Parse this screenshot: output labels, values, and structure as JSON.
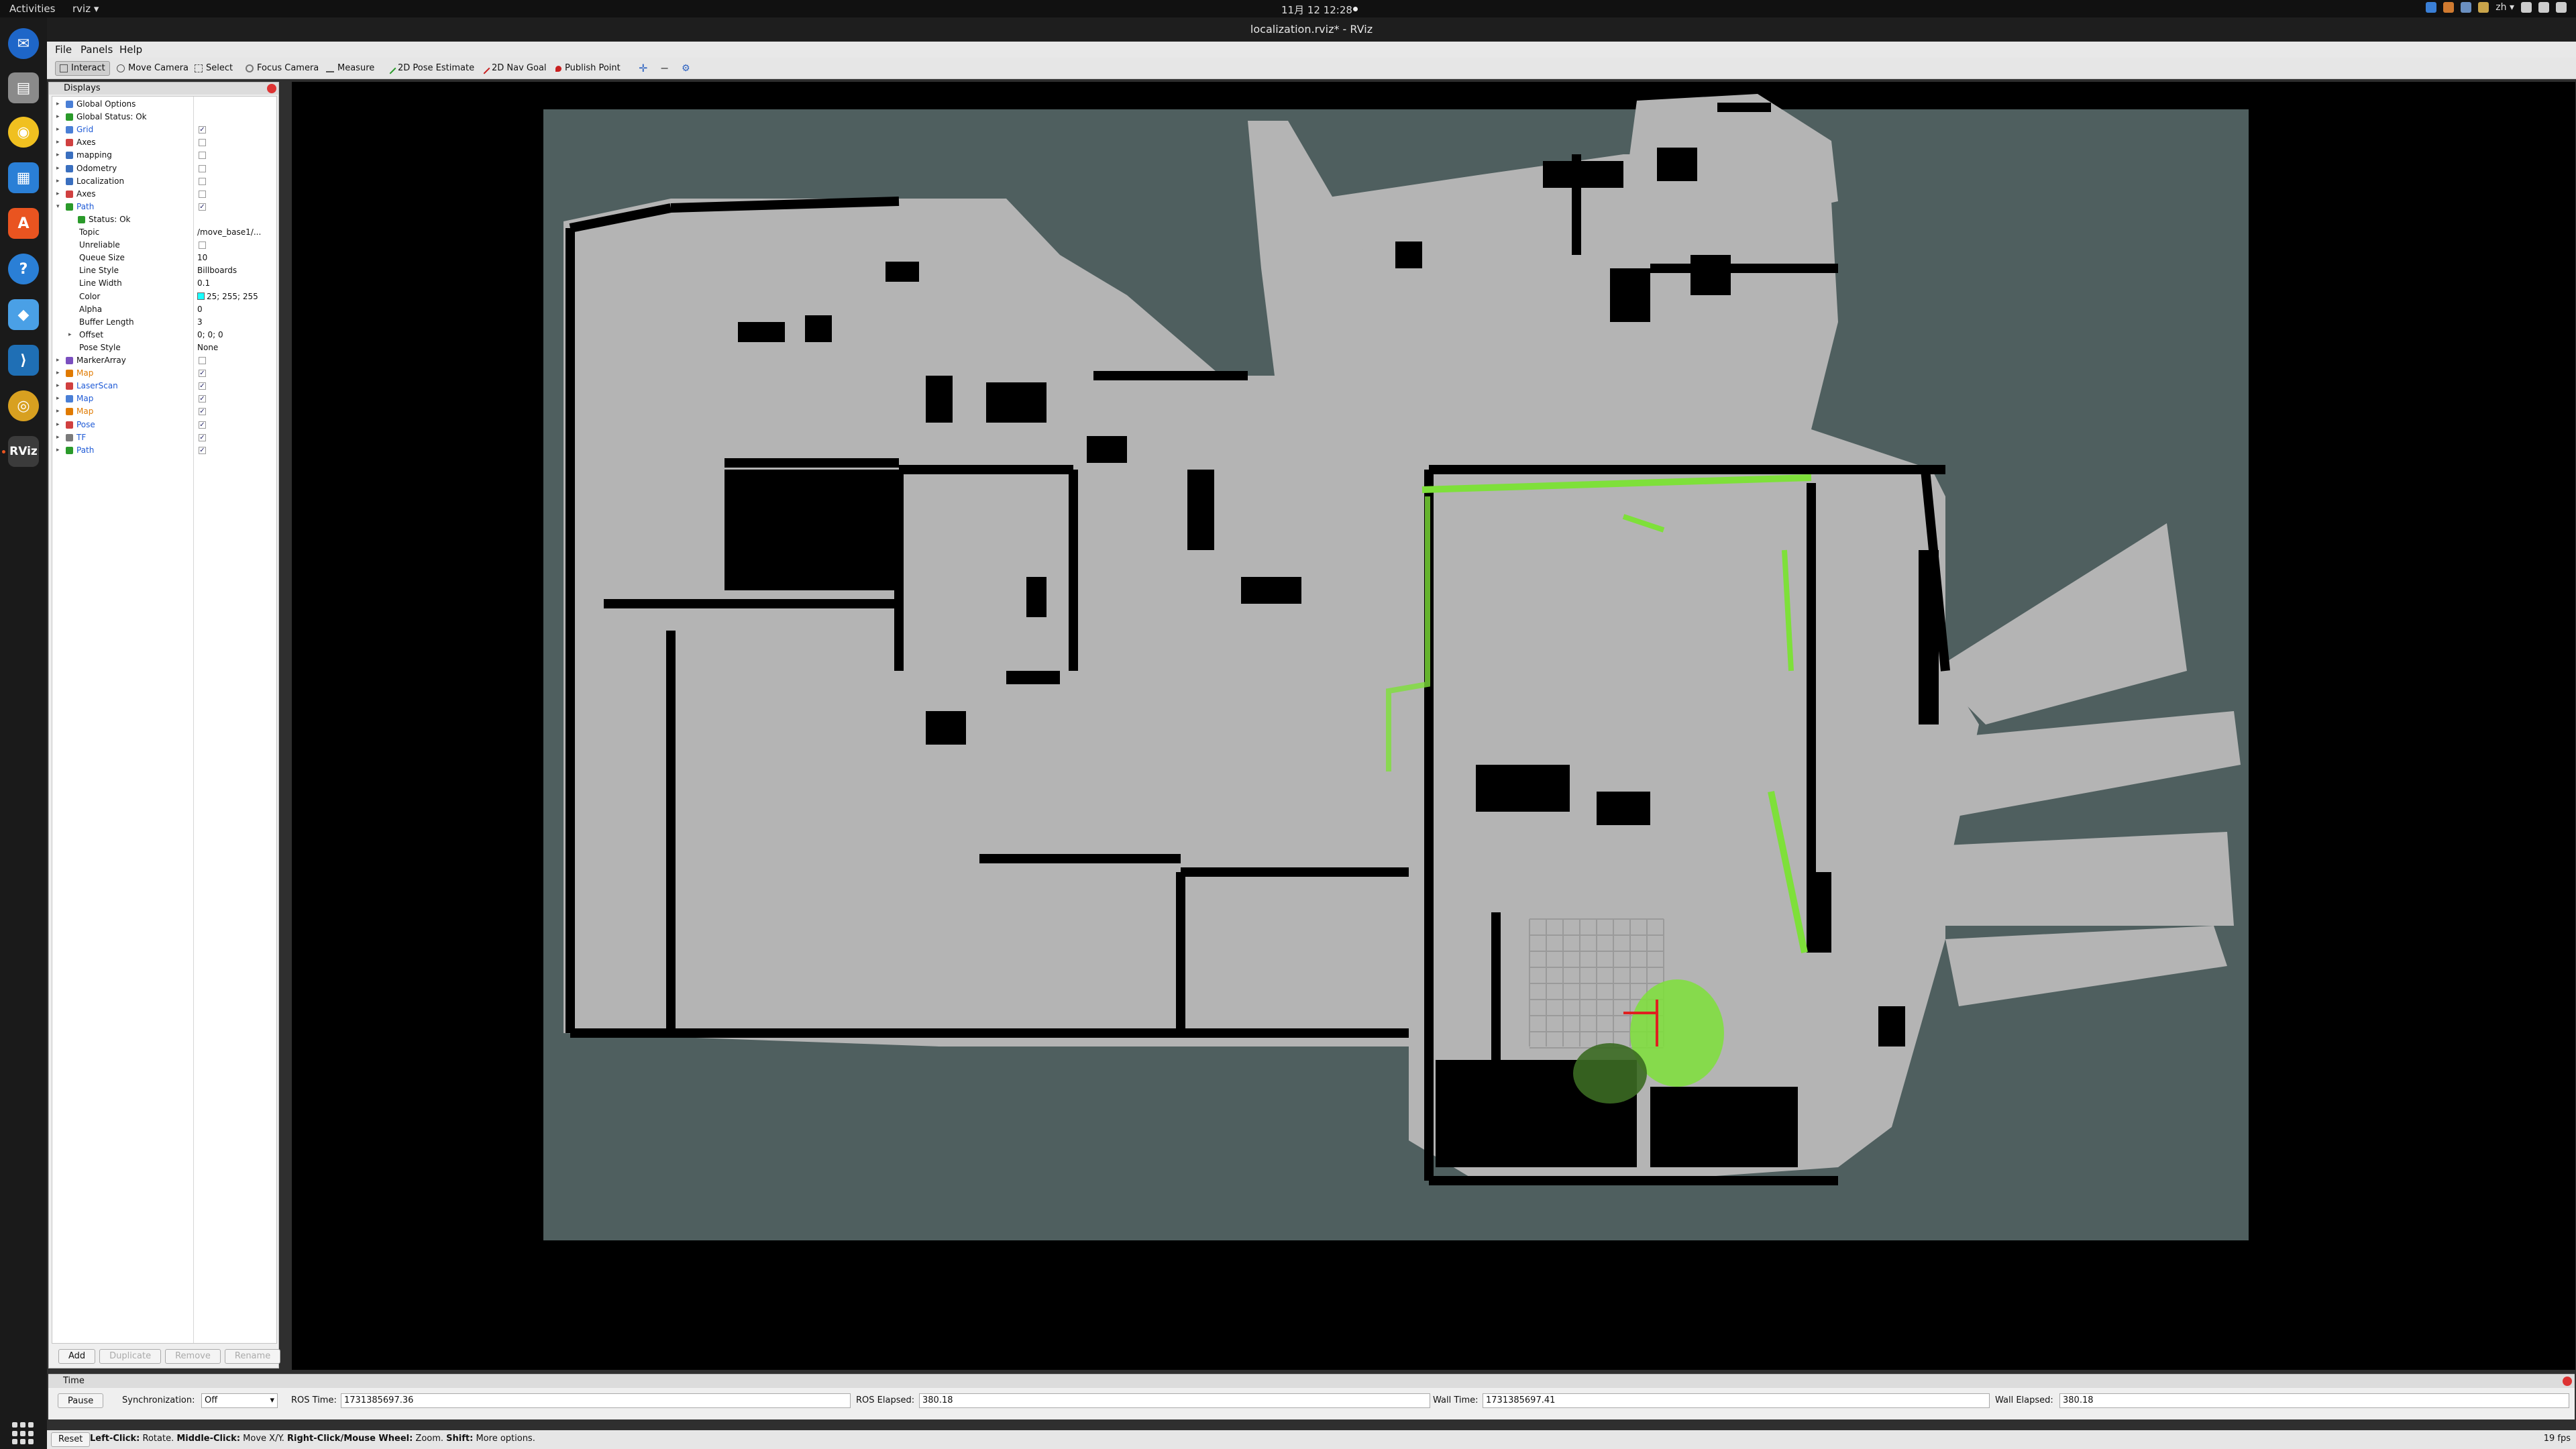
{
  "topbar": {
    "activities": "Activities",
    "app_menu": "rviz ▾",
    "clock": "11月 12  12:28",
    "input_method": "zh ▾"
  },
  "window": {
    "title": "localization.rviz* - RViz"
  },
  "menu": {
    "file": "File",
    "panels": "Panels",
    "help": "Help"
  },
  "toolbar": {
    "interact": "Interact",
    "move_camera": "Move Camera",
    "select": "Select",
    "focus_camera": "Focus Camera",
    "measure": "Measure",
    "pose_estimate": "2D Pose Estimate",
    "nav_goal": "2D Nav Goal",
    "publish_point": "Publish Point"
  },
  "displays": {
    "title": "Displays",
    "rows": [
      {
        "label": "Global Options",
        "indent": 0,
        "icon": "globe-icon",
        "color": "#4a7fd6"
      },
      {
        "label": "Global Status: Ok",
        "indent": 0,
        "icon": "check-icon",
        "color": "#2a9a2a"
      },
      {
        "label": "Grid",
        "indent": 0,
        "icon": "grid-icon",
        "color": "#4a7fd6",
        "style": "blue",
        "check": "✓"
      },
      {
        "label": "Axes",
        "indent": 0,
        "icon": "axes-icon",
        "color": "#d04040",
        "check": ""
      },
      {
        "label": "mapping",
        "indent": 0,
        "icon": "folder-icon",
        "color": "#3a6fbf",
        "check": ""
      },
      {
        "label": "Odometry",
        "indent": 0,
        "icon": "folder-icon",
        "color": "#3a6fbf",
        "check": ""
      },
      {
        "label": "Localization",
        "indent": 0,
        "icon": "folder-icon",
        "color": "#3a6fbf",
        "check": ""
      },
      {
        "label": "Axes",
        "indent": 0,
        "icon": "axes-icon",
        "color": "#d04040",
        "check": ""
      },
      {
        "label": "Path",
        "indent": 0,
        "icon": "path-icon",
        "color": "#2a9a2a",
        "style": "blue",
        "check": "✓",
        "open": true
      },
      {
        "label": "Status: Ok",
        "indent": 1,
        "icon": "check-icon",
        "color": "#2a9a2a"
      },
      {
        "label": "Topic",
        "indent": 1,
        "value": "/move_base1/..."
      },
      {
        "label": "Unreliable",
        "indent": 1,
        "check": ""
      },
      {
        "label": "Queue Size",
        "indent": 1,
        "value": "10"
      },
      {
        "label": "Line Style",
        "indent": 1,
        "value": "Billboards"
      },
      {
        "label": "Line Width",
        "indent": 1,
        "value": "0.1"
      },
      {
        "label": "Color",
        "indent": 1,
        "value": "25; 255; 255",
        "swatch": "#19ffff"
      },
      {
        "label": "Alpha",
        "indent": 1,
        "value": "0"
      },
      {
        "label": "Buffer Length",
        "indent": 1,
        "value": "3"
      },
      {
        "label": "Offset",
        "indent": 1,
        "value": "0; 0; 0",
        "arrow": true
      },
      {
        "label": "Pose Style",
        "indent": 1,
        "value": "None"
      },
      {
        "label": "MarkerArray",
        "indent": 0,
        "icon": "marker-icon",
        "color": "#7a4fbf",
        "check": ""
      },
      {
        "label": "Map",
        "indent": 0,
        "icon": "map-icon",
        "color": "#e07a00",
        "style": "orange",
        "check": "✓"
      },
      {
        "label": "LaserScan",
        "indent": 0,
        "icon": "laser-icon",
        "color": "#d04040",
        "style": "blue",
        "check": "✓"
      },
      {
        "label": "Map",
        "indent": 0,
        "icon": "map-icon",
        "color": "#4a7fd6",
        "style": "blue",
        "check": "✓"
      },
      {
        "label": "Map",
        "indent": 0,
        "icon": "map-icon",
        "color": "#e07a00",
        "style": "orange",
        "check": "✓"
      },
      {
        "label": "Pose",
        "indent": 0,
        "icon": "pose-icon",
        "color": "#d04040",
        "style": "blue",
        "check": "✓"
      },
      {
        "label": "TF",
        "indent": 0,
        "icon": "tf-icon",
        "color": "#7a7a7a",
        "style": "blue",
        "check": "✓"
      },
      {
        "label": "Path",
        "indent": 0,
        "icon": "path-icon",
        "color": "#2a9a2a",
        "style": "blue",
        "check": "✓"
      }
    ],
    "buttons": {
      "add": "Add",
      "duplicate": "Duplicate",
      "remove": "Remove",
      "rename": "Rename"
    }
  },
  "time": {
    "title": "Time",
    "pause": "Pause",
    "sync_label": "Synchronization:",
    "sync_value": "Off",
    "ros_time_label": "ROS Time:",
    "ros_time": "1731385697.36",
    "ros_elapsed_label": "ROS Elapsed:",
    "ros_elapsed": "380.18",
    "wall_time_label": "Wall Time:",
    "wall_time": "1731385697.41",
    "wall_elapsed_label": "Wall Elapsed:",
    "wall_elapsed": "380.18"
  },
  "status": {
    "reset": "Reset",
    "hint_lc": "Left-Click:",
    "hint_lc_t": " Rotate. ",
    "hint_mc": "Middle-Click:",
    "hint_mc_t": " Move X/Y. ",
    "hint_rc": "Right-Click/Mouse Wheel:",
    "hint_rc_t": " Zoom. ",
    "hint_sh": "Shift:",
    "hint_sh_t": " More options.",
    "fps": "19 fps"
  },
  "colors": {
    "map_free": "#b4b4b4",
    "map_unknown": "#4f5f5f",
    "map_occupied": "#000000",
    "path": "#7ee03a"
  }
}
